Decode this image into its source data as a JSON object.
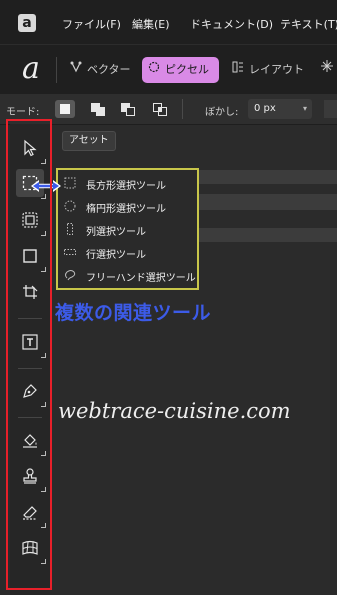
{
  "menubar": {
    "logo": "a",
    "items": [
      "ファイル(F)",
      "編集(E)",
      "ドキュメント(D)",
      "テキスト(T)"
    ]
  },
  "personas": {
    "brand": "a",
    "items": [
      {
        "label": "ベクター",
        "active": false,
        "icon": "vector-persona-icon"
      },
      {
        "label": "ピクセル",
        "active": true,
        "icon": "pixel-persona-icon"
      },
      {
        "label": "レイアウト",
        "active": false,
        "icon": "layout-persona-icon"
      }
    ],
    "accent": "#d98ae6"
  },
  "context": {
    "mode_label": "モード:",
    "feather_label": "ぼかし:",
    "feather_value": "0 px"
  },
  "tools": [
    {
      "name": "move-tool-icon"
    },
    {
      "name": "rectangular-selection-tool-icon",
      "active": true
    },
    {
      "name": "selection-brush-tool-icon"
    },
    {
      "name": "shape-tool-icon"
    },
    {
      "name": "crop-tool-icon"
    },
    {
      "name": "text-frame-tool-icon"
    },
    {
      "name": "pen-tool-icon"
    },
    {
      "name": "flood-fill-tool-icon"
    },
    {
      "name": "clone-stamp-tool-icon"
    },
    {
      "name": "eraser-tool-icon"
    },
    {
      "name": "mesh-warp-tool-icon"
    }
  ],
  "panel": {
    "asset_tab": "アセット"
  },
  "flyout": {
    "items": [
      {
        "label": "長方形選択ツール",
        "icon": "rectangle-marquee-icon"
      },
      {
        "label": "楕円形選択ツール",
        "icon": "ellipse-marquee-icon"
      },
      {
        "label": "列選択ツール",
        "icon": "column-marquee-icon"
      },
      {
        "label": "行選択ツール",
        "icon": "row-marquee-icon"
      },
      {
        "label": "フリーハンド選択ツール",
        "icon": "lasso-icon"
      }
    ],
    "border_color": "#c8c64a"
  },
  "annotation": {
    "text": "複数の関連ツール",
    "color": "#3c5be8",
    "frame_color": "#e8202a"
  },
  "watermark": "webtrace-cuisine.com"
}
